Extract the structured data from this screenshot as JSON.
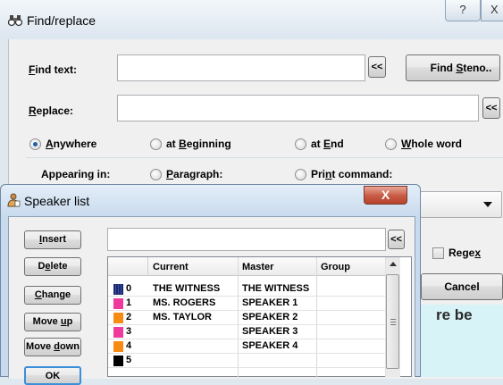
{
  "find_replace": {
    "title": "Find/replace",
    "help_glyph": "?",
    "close_glyph": "X",
    "find_label": "Find text:",
    "find_value": "",
    "find_history_button": "<<",
    "find_steno_button": "Find Steno..",
    "replace_label": "Replace:",
    "replace_value": "",
    "replace_history_button": "<<",
    "positions": [
      {
        "label": "Anywhere",
        "selected": true
      },
      {
        "label": "at Beginning",
        "selected": false
      },
      {
        "label": "at End",
        "selected": false
      },
      {
        "label": "Whole word",
        "selected": false
      }
    ],
    "appearing_in_label": "Appearing in:",
    "appearing_options": [
      {
        "label": "Paragraph:",
        "selected": false
      },
      {
        "label": "Print command:",
        "selected": false
      }
    ],
    "regex_label": "Regex",
    "regex_checked": false,
    "cancel_button": "Cancel",
    "background_text": "re be"
  },
  "speaker_list": {
    "title": "Speaker list",
    "close_glyph": "X",
    "buttons": [
      "Insert",
      "Delete",
      "Change",
      "Move up",
      "Move down",
      "OK"
    ],
    "search_value": "",
    "search_history_button": "<<",
    "columns": [
      "Current",
      "Master",
      "Group"
    ],
    "rows": [
      {
        "index": "0",
        "color": "#1c2a6e",
        "current": "THE WITNESS",
        "master": "THE WITNESS",
        "group": ""
      },
      {
        "index": "1",
        "color": "#f0399d",
        "current": "MS. ROGERS",
        "master": "SPEAKER 1",
        "group": ""
      },
      {
        "index": "2",
        "color": "#f78a12",
        "current": "MS. TAYLOR",
        "master": "SPEAKER 2",
        "group": ""
      },
      {
        "index": "3",
        "color": "#f0399d",
        "current": "",
        "master": "SPEAKER 3",
        "group": ""
      },
      {
        "index": "4",
        "color": "#f78a12",
        "current": "",
        "master": "SPEAKER 4",
        "group": ""
      },
      {
        "index": "5",
        "color": "#000000",
        "current": "",
        "master": "",
        "group": ""
      }
    ]
  }
}
